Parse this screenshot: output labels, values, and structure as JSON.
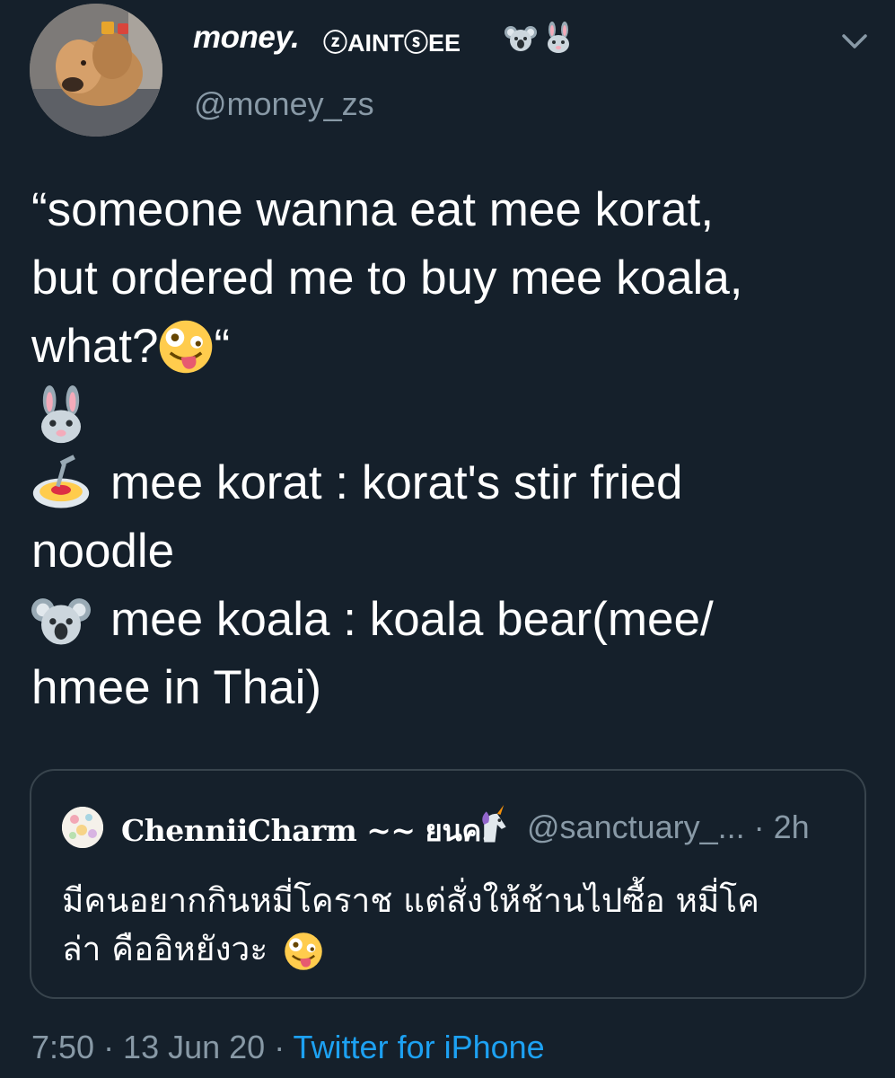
{
  "user": {
    "display_name": "money.",
    "name_badges": "ⓩAINTⓢEE",
    "handle": "@money_zs",
    "name_emojis": [
      "koala-emoji",
      "rabbit-emoji"
    ]
  },
  "tweet": {
    "line1": "“someone wanna eat mee korat,",
    "line2": "but ordered me to buy mee koala,",
    "line3": "what?",
    "line3_after": " “",
    "line5": "mee korat : korat's stir fried",
    "line6": "noodle",
    "line7": "mee koala : koala bear(mee/",
    "line8": "hmee in Thai)"
  },
  "quote": {
    "display_name": "ChenniiCharm ~~ ยนค.",
    "handle": "@sanctuary_...",
    "time": "· 2h",
    "text_line1": "มีคนอยากกินหมี่โคราช แต่สั่งให้ช้านไปซื้อ หมี่โค",
    "text_line2": "ล่า คืออิหยังวะ"
  },
  "footer": {
    "time": "7:50 · 13 Jun 20 · ",
    "source": "Twitter for iPhone"
  },
  "colors": {
    "background": "#15202b",
    "secondary_text": "#8899a6",
    "link": "#1da1f2",
    "border": "#38444d"
  }
}
